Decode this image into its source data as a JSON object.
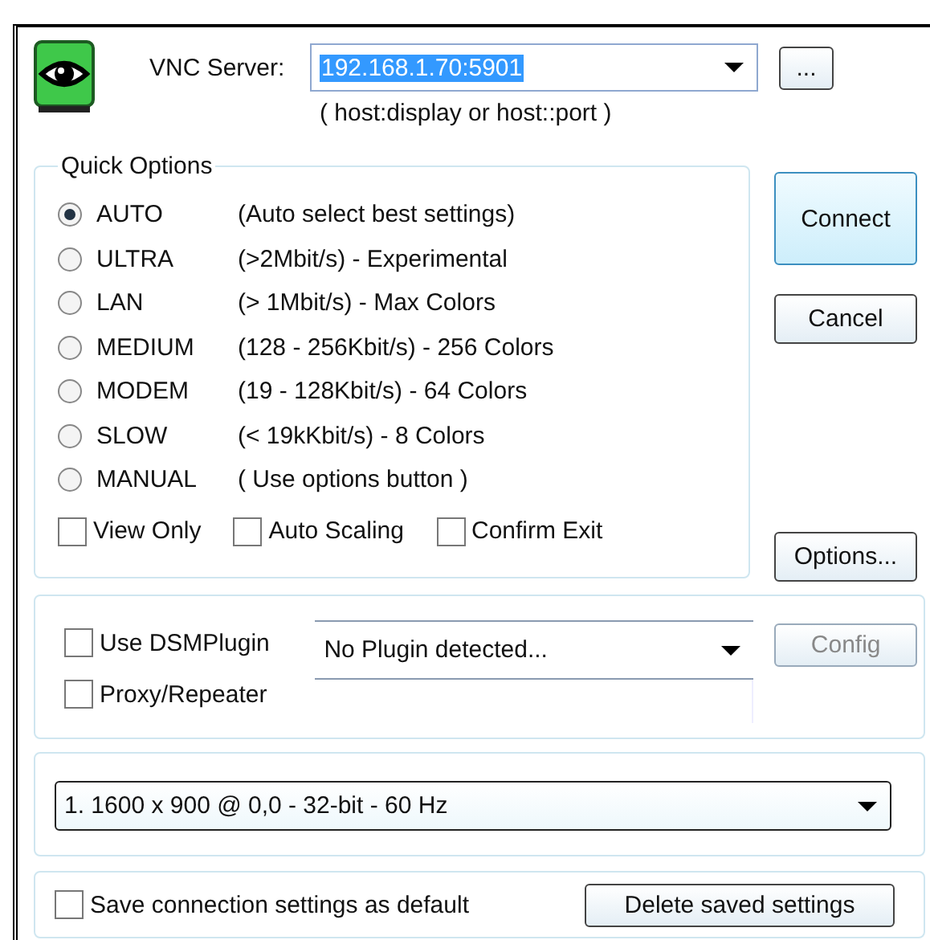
{
  "server": {
    "label": "VNC Server:",
    "value": "192.168.1.70:5901",
    "hint": "( host:display or host::port )"
  },
  "browse_button": "...",
  "quick_options": {
    "title": "Quick Options",
    "options": [
      {
        "label": "AUTO",
        "description": "(Auto select best settings)",
        "selected": true
      },
      {
        "label": "ULTRA",
        "description": "(>2Mbit/s) - Experimental",
        "selected": false
      },
      {
        "label": "LAN",
        "description": "(> 1Mbit/s) - Max Colors",
        "selected": false
      },
      {
        "label": "MEDIUM",
        "description": "(128 - 256Kbit/s) - 256 Colors",
        "selected": false
      },
      {
        "label": "MODEM",
        "description": "(19 - 128Kbit/s) - 64 Colors",
        "selected": false
      },
      {
        "label": "SLOW",
        "description": "(< 19kKbit/s) - 8 Colors",
        "selected": false
      },
      {
        "label": "MANUAL",
        "description": "( Use options button )",
        "selected": false
      }
    ],
    "checkboxes": [
      {
        "label": "View Only",
        "checked": false
      },
      {
        "label": "Auto Scaling",
        "checked": false
      },
      {
        "label": "Confirm Exit",
        "checked": false
      }
    ]
  },
  "side_buttons": {
    "connect": "Connect",
    "cancel": "Cancel",
    "options": "Options..."
  },
  "plugin": {
    "use_plugin": {
      "label": "Use DSMPlugin",
      "checked": false
    },
    "proxy": {
      "label": "Proxy/Repeater",
      "checked": false
    },
    "plugin_select": "No Plugin detected...",
    "config_button": {
      "label": "Config",
      "disabled": true
    }
  },
  "display_select": "1. 1600 x 900 @ 0,0 - 32-bit - 60 Hz",
  "save_default": {
    "label": "Save connection settings as default",
    "checked": false
  },
  "delete_button": "Delete saved settings"
}
